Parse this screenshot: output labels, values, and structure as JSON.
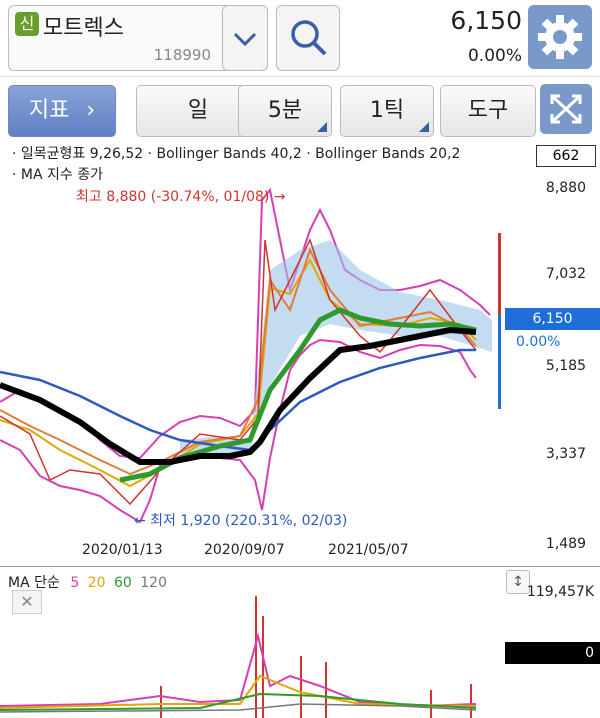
{
  "header": {
    "badge": "신",
    "stock_name": "모트렉스",
    "stock_code": "118990",
    "price": "6,150",
    "change_pct": "0.00%"
  },
  "toolbar": {
    "indicator_label": "지표",
    "period_label": "일",
    "minute_label": "5분",
    "tick_label": "1틱",
    "tools_label": "도구"
  },
  "legend": {
    "line1": "· 일목균형표 9,26,52 · Bollinger Bands 40,2 · Bollinger Bands 20,2",
    "line2": "· MA 지수 종가",
    "top_value": "662"
  },
  "chart": {
    "y_labels": [
      "8,880",
      "7,032",
      "5,185",
      "3,337",
      "1,489"
    ],
    "x_labels": [
      "2020/01/13",
      "2020/09/07",
      "2021/05/07"
    ],
    "high_annotation": "최고 8,880 (-30.74%, 01/08) →",
    "low_annotation": "← 최저 1,920 (220.31%, 02/03)",
    "current_price": "6,150",
    "current_pct": "0.00%",
    "colors": {
      "high": "#d0342c",
      "low": "#2a5bbd",
      "current": "#1f6ed8"
    }
  },
  "chart_data": {
    "type": "line",
    "ylim": [
      1489,
      8880
    ],
    "x": [
      "2020/01/13",
      "2020/09/07",
      "2021/05/07"
    ],
    "series": []
  },
  "volume": {
    "legend_title": "MA 단순",
    "ma_periods": [
      "5",
      "20",
      "60",
      "120"
    ],
    "ma_colors": [
      "#d63fb3",
      "#e0a800",
      "#2e9a2e",
      "#777777"
    ],
    "max_label": "119,457K",
    "zero_label": "0"
  },
  "icons": {
    "dropdown": "chevron-down-icon",
    "search": "search-icon",
    "settings": "gear-icon",
    "expand": "expand-icon",
    "close": "close-icon",
    "scroll": "scroll-icon"
  }
}
